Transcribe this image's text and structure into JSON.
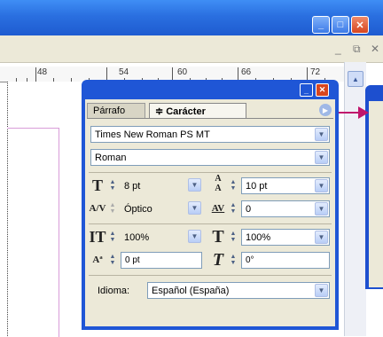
{
  "window": {
    "min_glyph": "_",
    "max_glyph": "□",
    "close_glyph": "✕",
    "mdi_min_glyph": "_",
    "mdi_restore_glyph": "⧉",
    "mdi_close_glyph": "✕"
  },
  "ruler": {
    "labels": [
      "48",
      "54",
      "60",
      "66",
      "72"
    ]
  },
  "panel": {
    "tabs": [
      {
        "label": "Párrafo"
      },
      {
        "label": "Carácter",
        "prefix": "≑"
      }
    ],
    "font_family": "Times New Roman PS MT",
    "font_style": "Roman",
    "font_size": "8 pt",
    "leading": "10 pt",
    "kerning": "Óptico",
    "tracking": "0",
    "vertical_scale": "100%",
    "horizontal_scale": "100%",
    "baseline_shift": "0 pt",
    "skew": "0°",
    "language_label": "Idioma:",
    "language": "Español (España)"
  },
  "icons": {
    "font_size": "font-size-icon",
    "leading": "leading-icon",
    "kerning": "kerning-icon",
    "tracking": "tracking-icon",
    "vertical_scale": "vertical-scale-icon",
    "horizontal_scale": "horizontal-scale-icon",
    "baseline_shift": "baseline-shift-icon",
    "skew": "skew-icon"
  },
  "colors": {
    "title_blue": "#1f56d6",
    "panel_bg": "#ece9d8",
    "callout": "#c0166c"
  }
}
